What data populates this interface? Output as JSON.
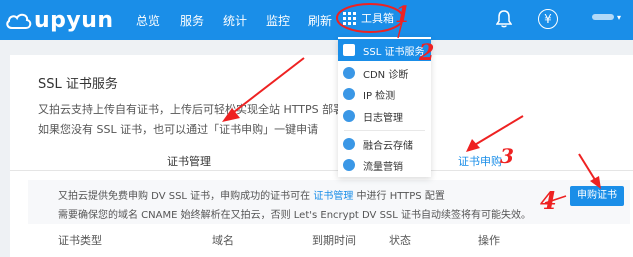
{
  "header": {
    "logo_text": "upyun",
    "nav": [
      "总览",
      "服务",
      "统计",
      "监控",
      "刷新"
    ],
    "tools_label": "工具箱",
    "yen_symbol": "¥",
    "user_caret": "▾"
  },
  "dropdown": {
    "items": [
      {
        "label": "SSL 证书服务",
        "icon": "certificate-icon"
      },
      {
        "label": "CDN 诊断",
        "icon": "pulse-icon"
      },
      {
        "label": "IP 检测",
        "icon": "location-icon"
      },
      {
        "label": "日志管理",
        "icon": "log-icon"
      },
      {
        "label": "融合云存储",
        "icon": "cloud-storage-icon"
      },
      {
        "label": "流量营销",
        "icon": "gift-icon"
      }
    ]
  },
  "page": {
    "title": "SSL 证书服务",
    "desc_line1": "又拍云支持上传自有证书，上传后可轻松实现全站 HTTPS 部署",
    "desc_line2": "如果您没有 SSL 证书，也可以通过「证书申购」一键申请"
  },
  "tabs": {
    "manage": "证书管理",
    "purchase": "证书申购"
  },
  "info": {
    "line1_a": "又拍云提供免费申购 DV SSL 证书，申购成功的证书可在 ",
    "line1_link": "证书管理",
    "line1_b": " 中进行 HTTPS 配置",
    "line2": "需要确保您的域名 CNAME 始终解析在又拍云，否则 Let's Encrypt DV SSL 证书自动续签将有可能失效。",
    "buy_button": "申购证书"
  },
  "table": {
    "columns": [
      "证书类型",
      "域名",
      "到期时间",
      "状态",
      "操作"
    ]
  },
  "annotations": {
    "numbers": [
      "1",
      "2",
      "3",
      "4"
    ],
    "color": "#e22222"
  },
  "colors": {
    "brand": "#1a8ee8",
    "panel_bg": "#ffffff",
    "page_bg": "#eef1f4"
  }
}
